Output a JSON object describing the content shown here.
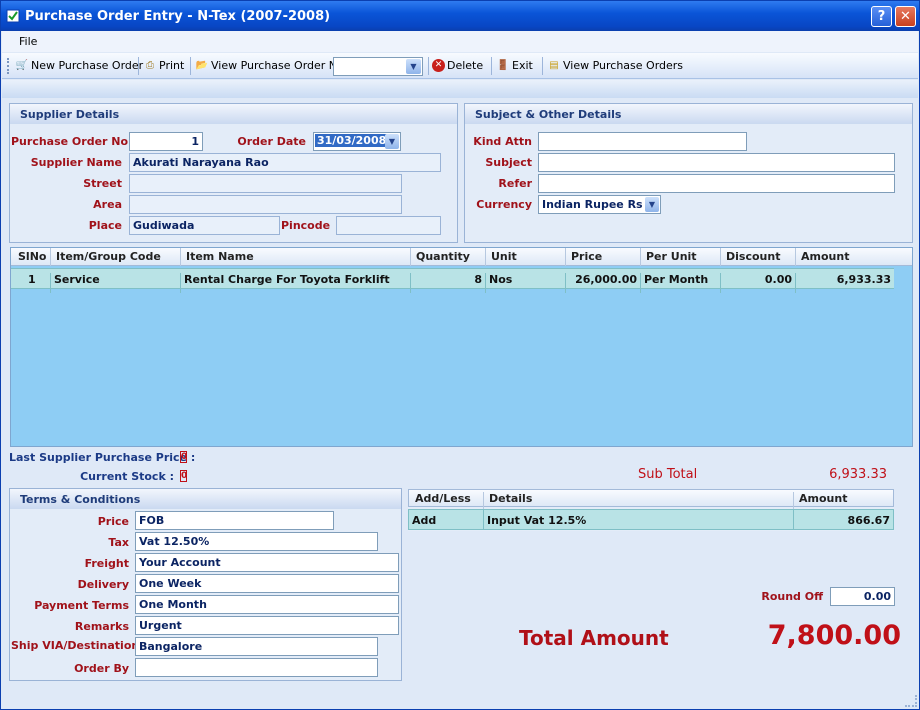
{
  "window": {
    "title": "Purchase Order Entry - N-Tex (2007-2008)",
    "help_glyph": "?",
    "close_glyph": "✕"
  },
  "menu": {
    "file": "File"
  },
  "toolbar": {
    "new_po": "New Purchase Order",
    "print": "Print",
    "view_po_no": "View Purchase Order No",
    "po_no_value": "",
    "delete": "Delete",
    "exit": "Exit",
    "view_pos": "View Purchase Orders"
  },
  "supplier": {
    "heading": "Supplier Details",
    "po_no_label": "Purchase Order No",
    "po_no": "1",
    "order_date_label": "Order Date",
    "order_date": "31/03/2008",
    "supplier_name_label": "Supplier Name",
    "supplier_name": "Akurati Narayana Rao",
    "street_label": "Street",
    "street": "",
    "area_label": "Area",
    "area": "",
    "place_label": "Place",
    "place": "Gudiwada",
    "pincode_label": "Pincode",
    "pincode": ""
  },
  "subject": {
    "heading": "Subject & Other Details",
    "kind_attn_label": "Kind Attn",
    "kind_attn": "",
    "subject_label": "Subject",
    "subject": "",
    "refer_label": "Refer",
    "refer": "",
    "currency_label": "Currency",
    "currency": "Indian Rupee Rs"
  },
  "items": {
    "headers": {
      "slno": "SlNo",
      "code": "Item/Group Code",
      "name": "Item Name",
      "qty": "Quantity",
      "unit": "Unit",
      "price": "Price",
      "per_unit": "Per Unit",
      "discount": "Discount",
      "amount": "Amount"
    },
    "rows": [
      {
        "slno": "1",
        "code": "Service",
        "name": "Rental Charge For Toyota Forklift",
        "qty": "8",
        "unit": "Nos",
        "price": "26,000.00",
        "per_unit": "Per Month",
        "discount": "0.00",
        "amount": "6,933.33"
      }
    ]
  },
  "stats": {
    "last_price_label": "Last Supplier Purchase Price :",
    "last_price": "0",
    "stock_label": "Current Stock :",
    "stock": "0"
  },
  "terms": {
    "heading": "Terms & Conditions",
    "price_label": "Price",
    "price": "FOB",
    "tax_label": "Tax",
    "tax": "Vat 12.50%",
    "freight_label": "Freight",
    "freight": "Your Account",
    "delivery_label": "Delivery",
    "delivery": "One Week",
    "payment_label": "Payment Terms",
    "payment": "One Month",
    "remarks_label": "Remarks",
    "remarks": "Urgent",
    "ship_label": "Ship VIA/Destination",
    "ship": "Bangalore",
    "order_by_label": "Order By",
    "order_by": ""
  },
  "totals": {
    "subtotal_label": "Sub Total",
    "subtotal": "6,933.33",
    "add_headers": {
      "addless": "Add/Less",
      "details": "Details",
      "amount": "Amount"
    },
    "add_rows": [
      {
        "addless": "Add",
        "details": "Input Vat 12.5%",
        "amount": "866.67"
      }
    ],
    "round_off_label": "Round Off",
    "round_off": "0.00",
    "total_label": "Total Amount",
    "total": "7,800.00"
  }
}
